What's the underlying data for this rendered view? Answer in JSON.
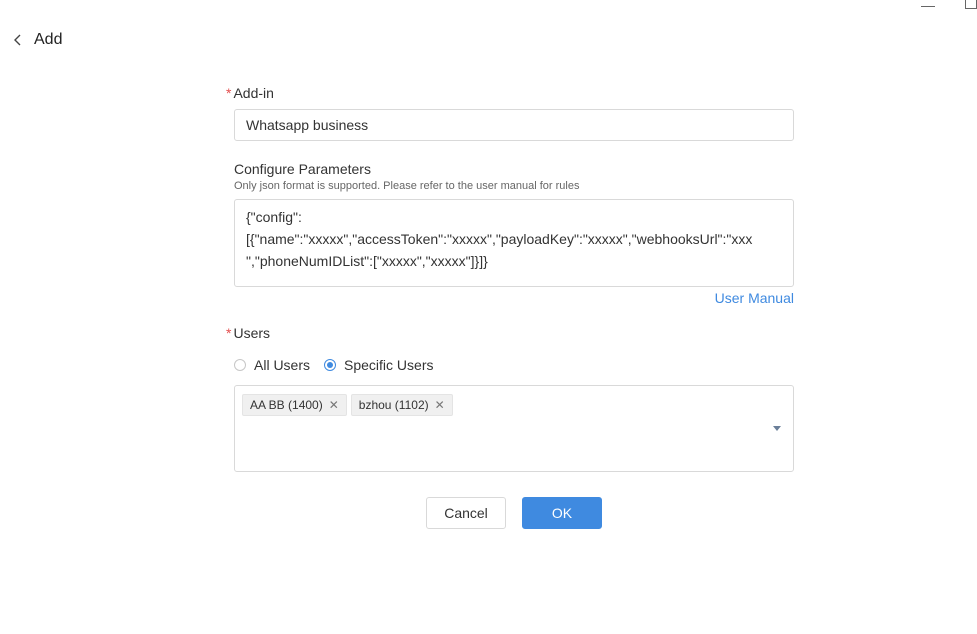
{
  "header": {
    "title": "Add",
    "back_icon": "chevron-left-icon"
  },
  "form": {
    "addin": {
      "label": "Add-in",
      "value": "Whatsapp business"
    },
    "params": {
      "label": "Configure Parameters",
      "hint": "Only json format is supported. Please refer to the user manual for rules",
      "value": "{\"config\":\n[{\"name\":\"xxxxx\",\"accessToken\":\"xxxxx\",\"payloadKey\":\"xxxxx\",\"webhooksUrl\":\"xxx\n\",\"phoneNumIDList\":[\"xxxxx\",\"xxxxx\"]}]}",
      "manual_link": "User Manual"
    },
    "users": {
      "label": "Users",
      "options": [
        {
          "label": "All Users",
          "checked": false
        },
        {
          "label": "Specific Users",
          "checked": true
        }
      ],
      "selected": [
        {
          "label": "AA BB (1400)"
        },
        {
          "label": "bzhou (1102)"
        }
      ]
    }
  },
  "actions": {
    "cancel": "Cancel",
    "ok": "OK"
  },
  "colors": {
    "accent": "#3f8ae0",
    "required": "#e34d4d"
  }
}
